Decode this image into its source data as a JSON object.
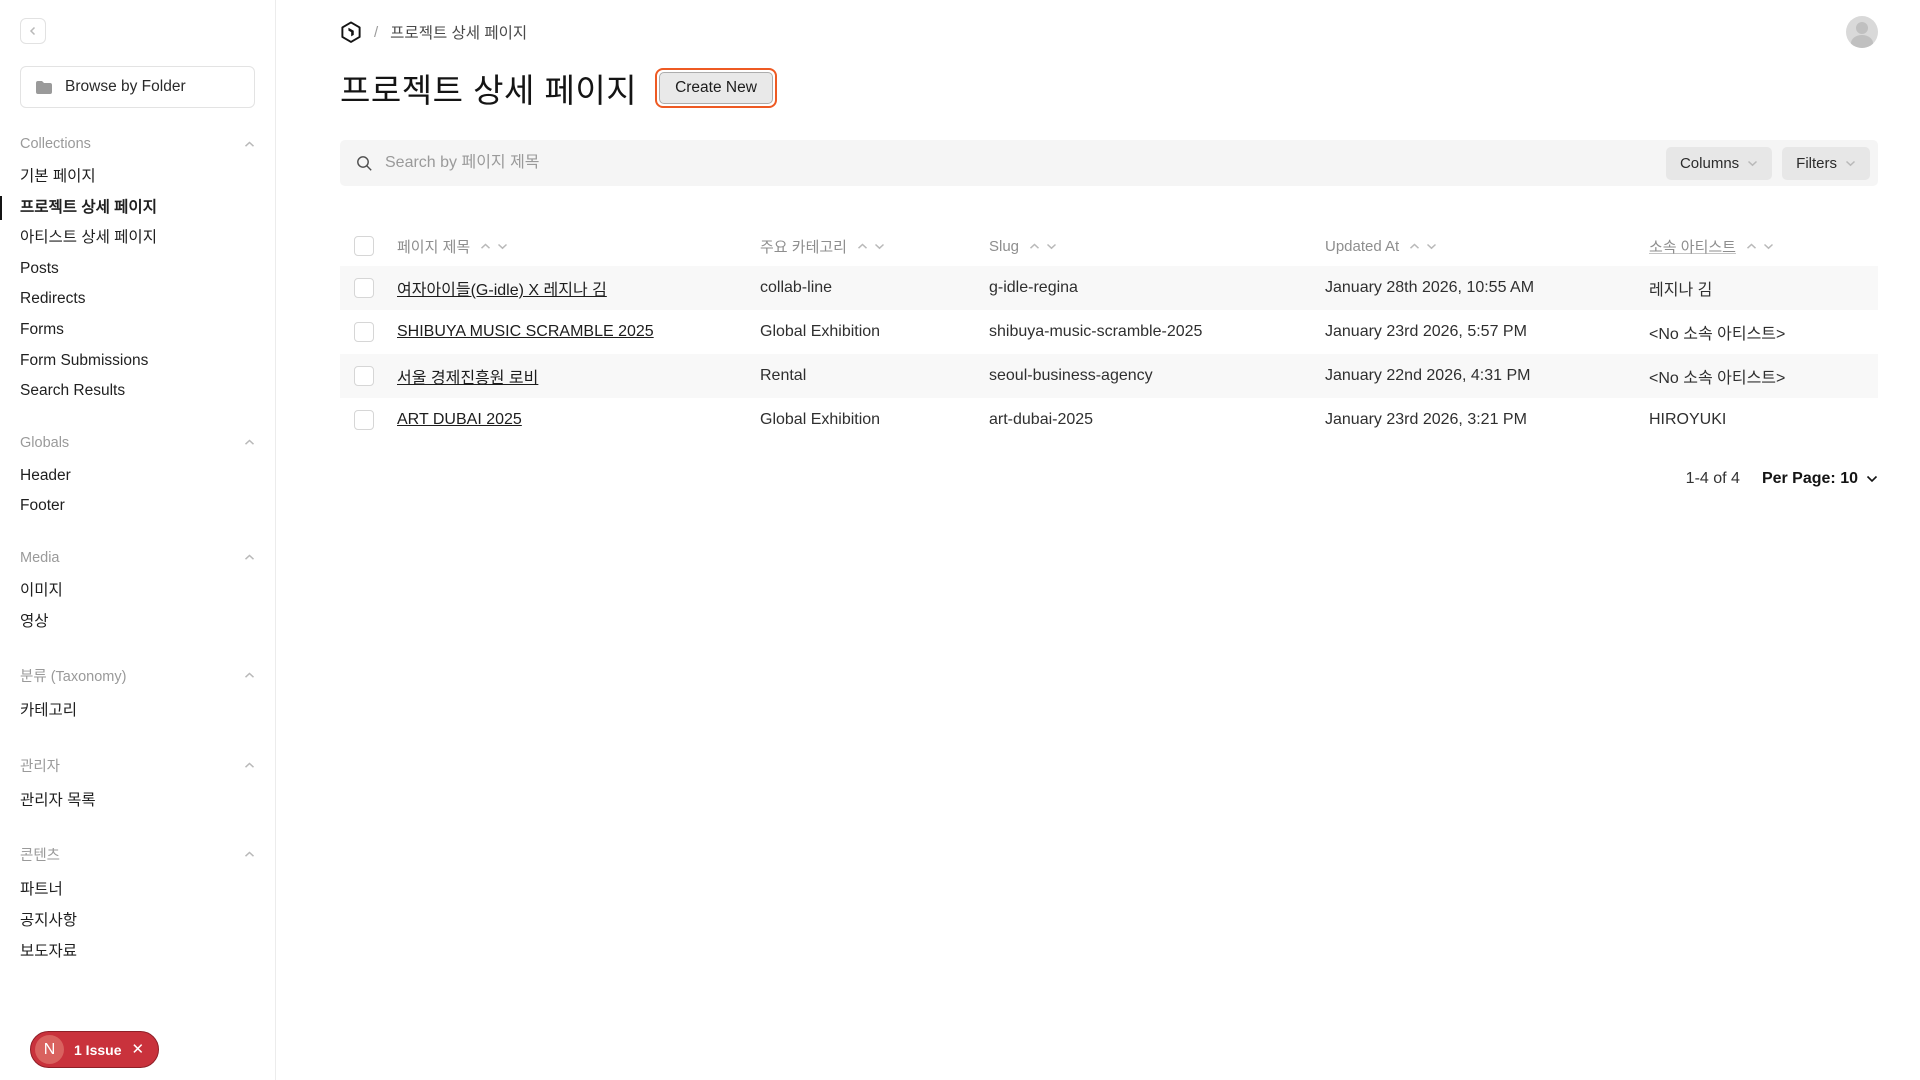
{
  "app": {
    "breadcrumb_separator": "/",
    "breadcrumb": "프로젝트 상세 페이지"
  },
  "sidebar": {
    "browse_by_folder": "Browse by Folder",
    "groups": [
      {
        "label": "Collections",
        "items": [
          {
            "label": "기본 페이지",
            "active": false
          },
          {
            "label": "프로젝트 상세 페이지",
            "active": true
          },
          {
            "label": "아티스트 상세 페이지",
            "active": false
          },
          {
            "label": "Posts",
            "active": false
          },
          {
            "label": "Redirects",
            "active": false
          },
          {
            "label": "Forms",
            "active": false
          },
          {
            "label": "Form Submissions",
            "active": false
          },
          {
            "label": "Search Results",
            "active": false
          }
        ]
      },
      {
        "label": "Globals",
        "items": [
          {
            "label": "Header",
            "active": false
          },
          {
            "label": "Footer",
            "active": false
          }
        ]
      },
      {
        "label": "Media",
        "items": [
          {
            "label": "이미지",
            "active": false
          },
          {
            "label": "영상",
            "active": false
          }
        ]
      },
      {
        "label": "분류 (Taxonomy)",
        "items": [
          {
            "label": "카테고리",
            "active": false
          }
        ]
      },
      {
        "label": "관리자",
        "items": [
          {
            "label": "관리자 목록",
            "active": false
          }
        ]
      },
      {
        "label": "콘텐츠",
        "items": [
          {
            "label": "파트너",
            "active": false
          },
          {
            "label": "공지사항",
            "active": false
          },
          {
            "label": "보도자료",
            "active": false
          }
        ]
      }
    ]
  },
  "header": {
    "title": "프로젝트 상세 페이지",
    "create_button": "Create New"
  },
  "controls": {
    "search_placeholder": "Search by 페이지 제목",
    "columns_label": "Columns",
    "filters_label": "Filters"
  },
  "table": {
    "columns": [
      {
        "label": "페이지 제목",
        "underlined": false
      },
      {
        "label": "주요 카테고리",
        "underlined": false
      },
      {
        "label": "Slug",
        "underlined": false
      },
      {
        "label": "Updated At",
        "underlined": false
      },
      {
        "label": "소속 아티스트",
        "underlined": true
      }
    ],
    "rows": [
      {
        "title": "여자아이들(G-idle) X 레지나 김",
        "category": "collab-line",
        "slug": "g-idle-regina",
        "updated_at": "January 28th 2026, 10:55 AM",
        "artist": "레지나 김"
      },
      {
        "title": "SHIBUYA MUSIC SCRAMBLE 2025",
        "category": "Global Exhibition",
        "slug": "shibuya-music-scramble-2025",
        "updated_at": "January 23rd 2026, 5:57 PM",
        "artist": "<No 소속 아티스트>"
      },
      {
        "title": "서울 경제진흥원 로비",
        "category": "Rental",
        "slug": "seoul-business-agency",
        "updated_at": "January 22nd 2026, 4:31 PM",
        "artist": "<No 소속 아티스트>"
      },
      {
        "title": "ART DUBAI 2025",
        "category": "Global Exhibition",
        "slug": "art-dubai-2025",
        "updated_at": "January 23rd 2026, 3:21 PM",
        "artist": "HIROYUKI"
      }
    ]
  },
  "pagination": {
    "range": "1-4 of 4",
    "per_page_label": "Per Page: 10"
  },
  "dev_badge": {
    "logo_letter": "N",
    "label": "1 Issue"
  },
  "colors": {
    "accent_ring": "#ee5a23",
    "badge_red": "#c9323c",
    "row_stripe": "#f8f8f8"
  }
}
